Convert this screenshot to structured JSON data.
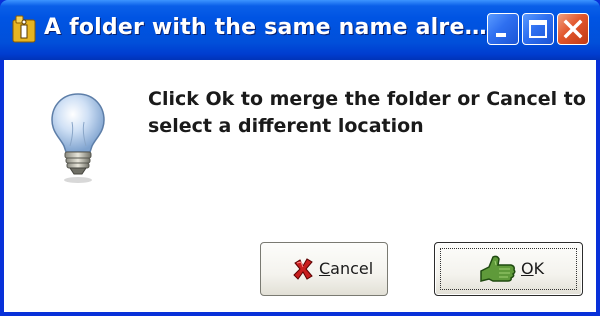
{
  "window": {
    "title": "A folder with the same name alre…",
    "controls": {
      "minimize_icon": "minimize-icon",
      "maximize_icon": "maximize-icon",
      "close_icon": "close-icon"
    }
  },
  "dialog": {
    "icon": "lightbulb-icon",
    "message": "Click Ok to merge the folder or Cancel to select a different location"
  },
  "buttons": {
    "cancel": {
      "mnemonic": "C",
      "rest": "ancel",
      "icon": "cross-icon"
    },
    "ok": {
      "mnemonic": "O",
      "rest": "K",
      "icon": "thumbs-up-icon"
    }
  },
  "colors": {
    "titlebar": "#0054e3",
    "close_button": "#e2562c",
    "button_face": "#f4f3ee"
  }
}
